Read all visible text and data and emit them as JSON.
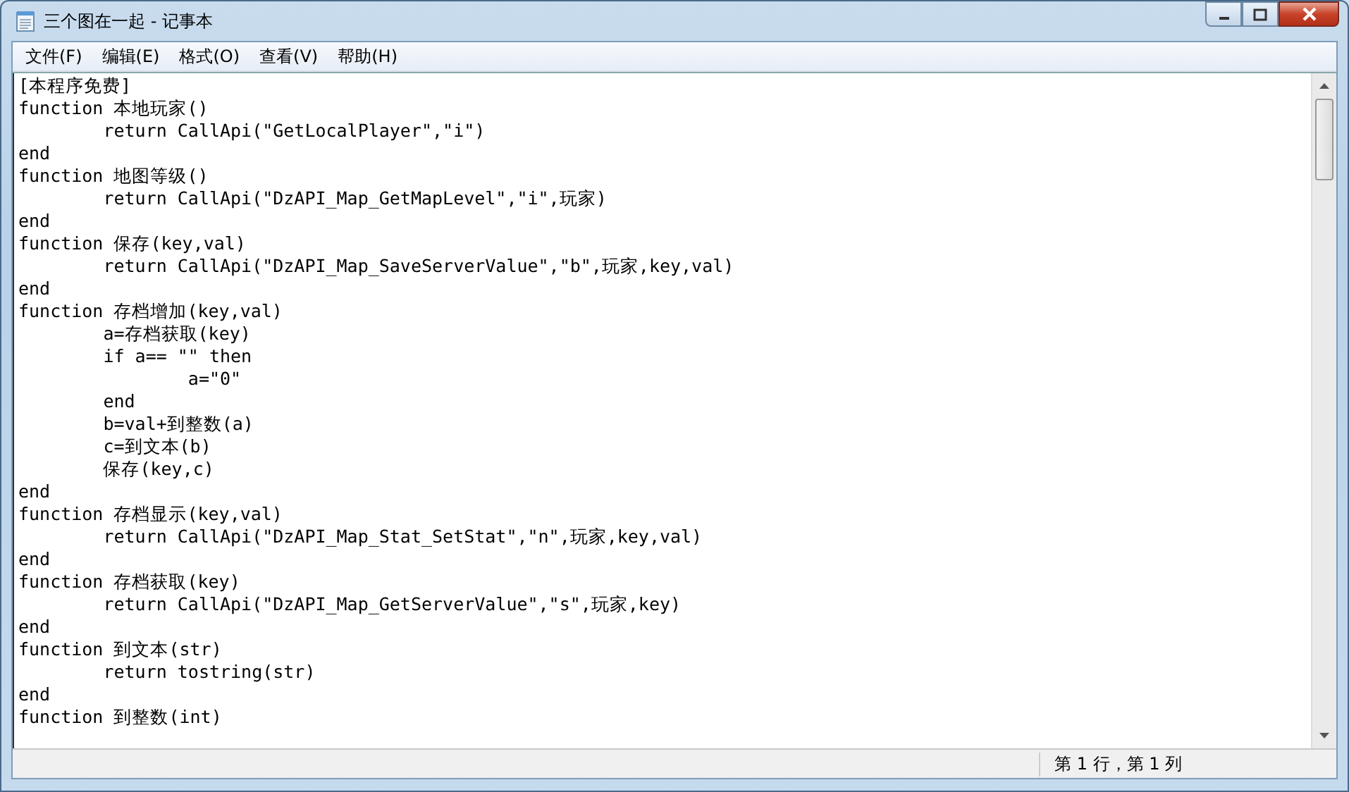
{
  "window": {
    "title": "三个图在一起 - 记事本"
  },
  "menu": [
    "文件(F)",
    "编辑(E)",
    "格式(O)",
    "查看(V)",
    "帮助(H)"
  ],
  "lines": [
    "[本程序免费]",
    "function 本地玩家()",
    "\treturn CallApi(\"GetLocalPlayer\",\"i\")",
    "end",
    "function 地图等级()",
    "\treturn CallApi(\"DzAPI_Map_GetMapLevel\",\"i\",玩家)",
    "end",
    "function 保存(key,val)",
    "\treturn CallApi(\"DzAPI_Map_SaveServerValue\",\"b\",玩家,key,val)",
    "end",
    "function 存档增加(key,val)",
    "\ta=存档获取(key)",
    "\tif a== \"\" then",
    "\t\ta=\"0\"",
    "\tend",
    "\tb=val+到整数(a)",
    "\tc=到文本(b)",
    "\t保存(key,c)",
    "end",
    "function 存档显示(key,val)",
    "\treturn CallApi(\"DzAPI_Map_Stat_SetStat\",\"n\",玩家,key,val)",
    "end",
    "function 存档获取(key)",
    "\treturn CallApi(\"DzAPI_Map_GetServerValue\",\"s\",玩家,key)",
    "end",
    "function 到文本(str)",
    "\treturn tostring(str)",
    "end",
    "function 到整数(int)"
  ],
  "status_bar": {
    "position": "第 1 行，第 1 列"
  }
}
